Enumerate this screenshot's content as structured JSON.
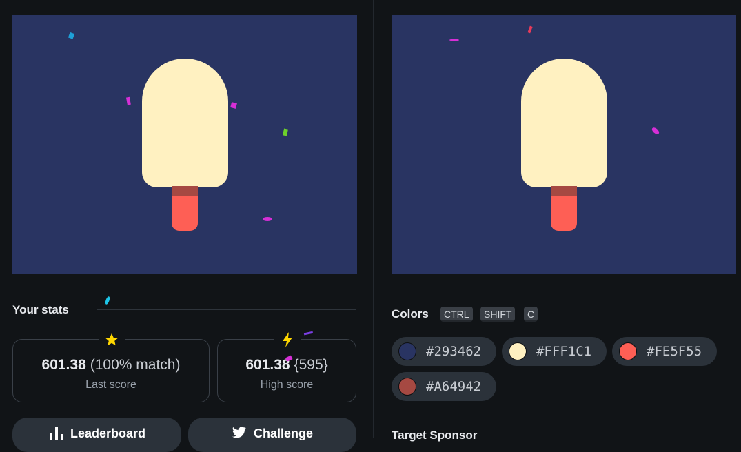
{
  "stats": {
    "title": "Your stats",
    "last_score": {
      "value": "601.38",
      "match": "(100% match)",
      "label": "Last score",
      "icon": "star-icon"
    },
    "high_score": {
      "value": "601.38",
      "target": "{595}",
      "label": "High score",
      "icon": "lightning-icon"
    }
  },
  "buttons": {
    "leaderboard": {
      "label": "Leaderboard",
      "icon": "bar-chart-icon"
    },
    "challenge": {
      "label": "Challenge",
      "icon": "twitter-bird-icon"
    }
  },
  "colors_section": {
    "title": "Colors",
    "shortcut_keys": [
      "CTRL",
      "SHIFT",
      "C"
    ],
    "swatches": [
      {
        "hex": "#293462"
      },
      {
        "hex": "#FFF1C1"
      },
      {
        "hex": "#FE5F55"
      },
      {
        "hex": "#A64942"
      }
    ]
  },
  "bottom_section": {
    "title": "Target Sponsor"
  },
  "theme": {
    "background": "#111417",
    "canvas": "#293462",
    "cream": "#FFF1C1",
    "coral": "#FE5F55",
    "brick": "#A64942",
    "star": "#FFD700"
  }
}
